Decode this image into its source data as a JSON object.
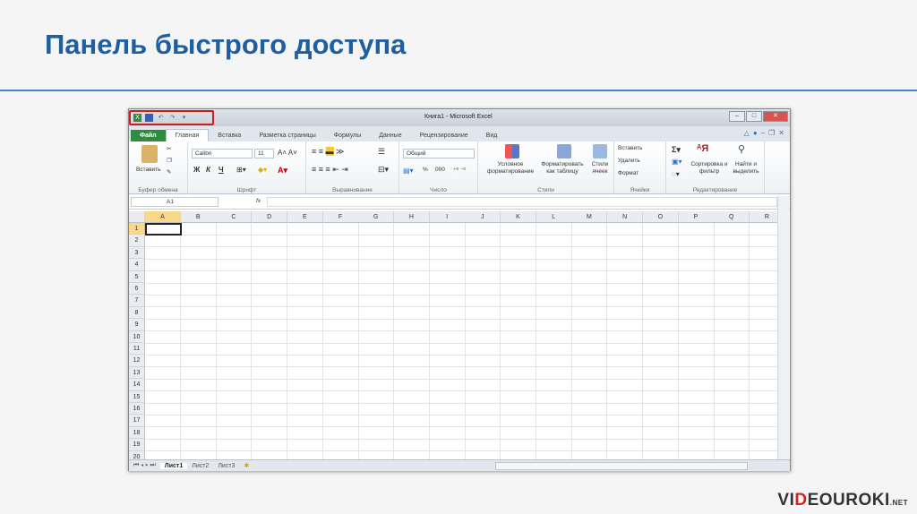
{
  "slide": {
    "title": "Панель быстрого доступа",
    "logo": "VIDEOUROKI.NET"
  },
  "excel": {
    "window_title": "Книга1 - Microsoft Excel",
    "qat": {
      "items": [
        "excel-icon",
        "save-icon",
        "undo-icon",
        "redo-icon",
        "customize-icon"
      ],
      "highlight_color": "#c81e1e"
    },
    "tabs": [
      "Файл",
      "Главная",
      "Вставка",
      "Разметка страницы",
      "Формулы",
      "Данные",
      "Рецензирование",
      "Вид"
    ],
    "ribbon": {
      "clipboard": {
        "label": "Буфер обмена",
        "paste": "Вставить"
      },
      "font": {
        "label": "Шрифт",
        "name": "Calibri",
        "size": "11",
        "bold": "Ж",
        "italic": "К",
        "underline": "Ч"
      },
      "alignment": {
        "label": "Выравнивание"
      },
      "number": {
        "label": "Число",
        "format": "Общий",
        "percent": "%",
        "thousands": "000"
      },
      "styles": {
        "label": "Стили",
        "conditional": "Условное форматирование",
        "table": "Форматировать как таблицу",
        "cell_styles": "Стили ячеек"
      },
      "cells": {
        "label": "Ячейки",
        "insert": "Вставить",
        "delete": "Удалить",
        "format": "Формат"
      },
      "editing": {
        "label": "Редактирование",
        "sort": "Сортировка и фильтр",
        "find": "Найти и выделить"
      }
    },
    "name_box": "A1",
    "fx": "fx",
    "columns": [
      "A",
      "B",
      "C",
      "D",
      "E",
      "F",
      "G",
      "H",
      "I",
      "J",
      "K",
      "L",
      "M",
      "N",
      "O",
      "P",
      "Q",
      "R"
    ],
    "rows": [
      "1",
      "2",
      "3",
      "4",
      "5",
      "6",
      "7",
      "8",
      "9",
      "10",
      "11",
      "12",
      "13",
      "14",
      "15",
      "16",
      "17",
      "18",
      "19",
      "20"
    ],
    "sheets": [
      "Лист1",
      "Лист2",
      "Лист3"
    ]
  }
}
